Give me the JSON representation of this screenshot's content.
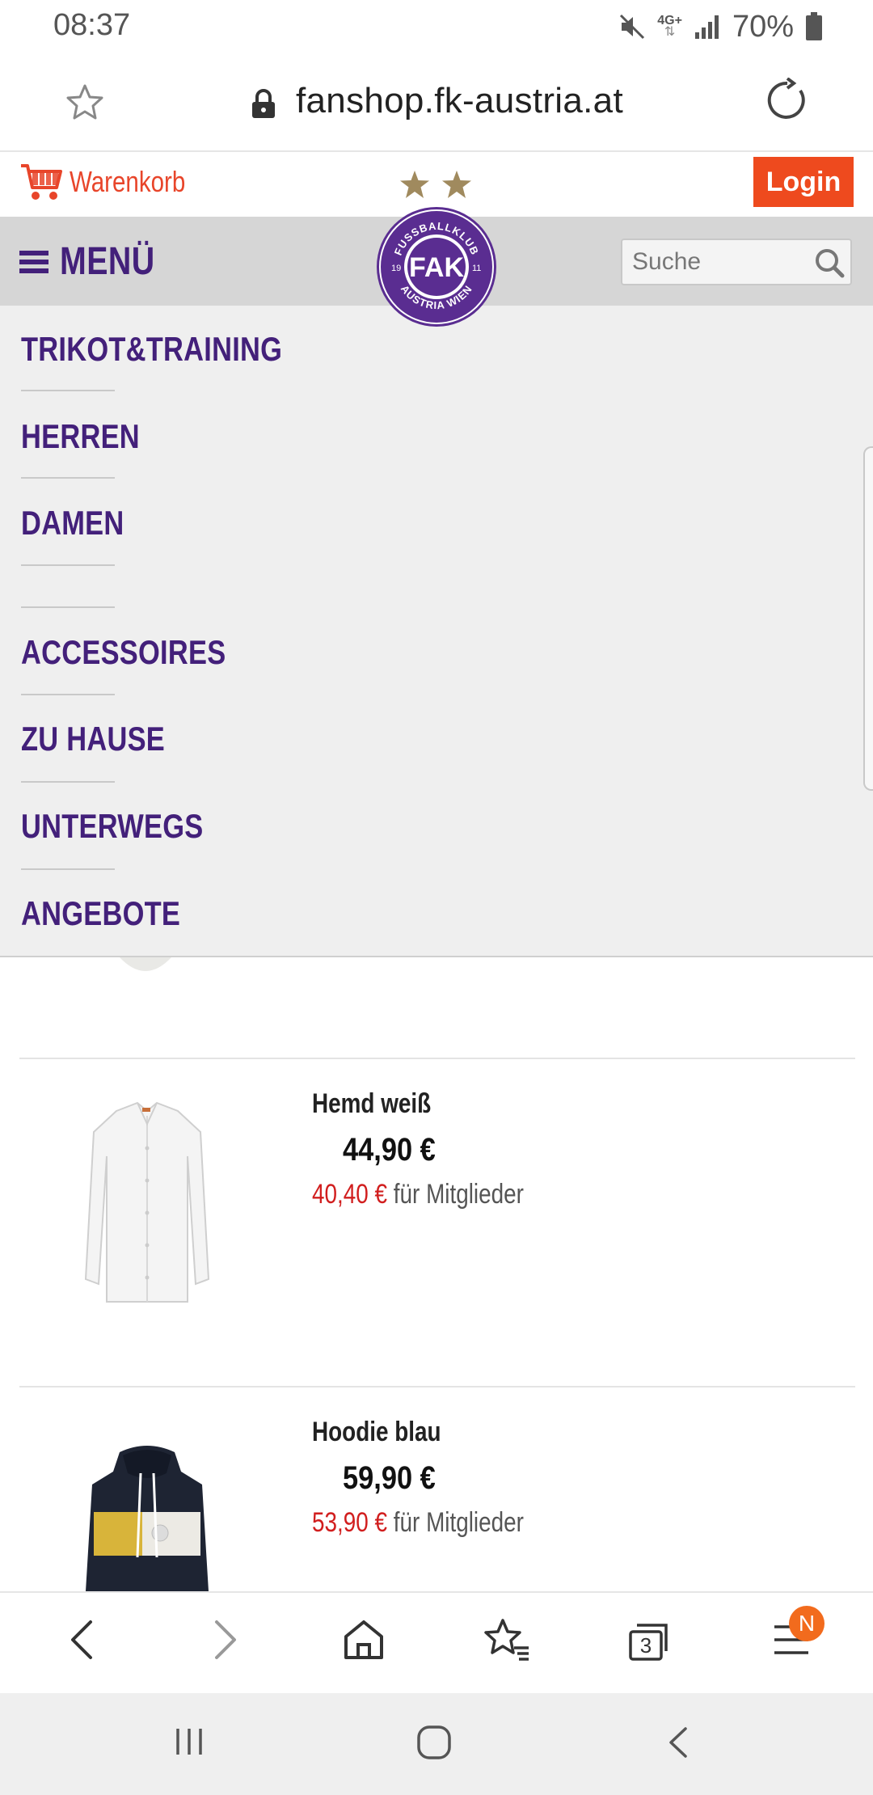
{
  "status_bar": {
    "time": "08:37",
    "network": "4G+",
    "battery": "70%"
  },
  "browser": {
    "url": "fanshop.fk-austria.at",
    "tab_count": "3",
    "menu_badge": "N"
  },
  "header": {
    "cart_label": "Warenkorb",
    "login_label": "Login",
    "menu_label": "MENÜ",
    "search_placeholder": "Suche",
    "logo": {
      "top_text": "FUSSBALLKLUB",
      "bottom_text": "AUSTRIA WIEN",
      "year_left": "19",
      "year_right": "11",
      "letters": "FAK"
    }
  },
  "menu": {
    "items": [
      "TRIKOT&TRAINING",
      "HERREN",
      "DAMEN",
      "ACCESSOIRES",
      "ZU HAUSE",
      "UNTERWEGS",
      "ANGEBOTE"
    ]
  },
  "products": [
    {
      "name": "Hemd weiß",
      "price": "44,90 €",
      "member_price": "40,40 €",
      "member_text": "für Mitglieder"
    },
    {
      "name": "Hoodie blau",
      "price": "59,90 €",
      "member_price": "53,90 €",
      "member_text": "für Mitglieder"
    }
  ],
  "colors": {
    "brand_purple": "#43207a",
    "accent_orange": "#ee4a1e",
    "member_red": "#d11e1e"
  }
}
